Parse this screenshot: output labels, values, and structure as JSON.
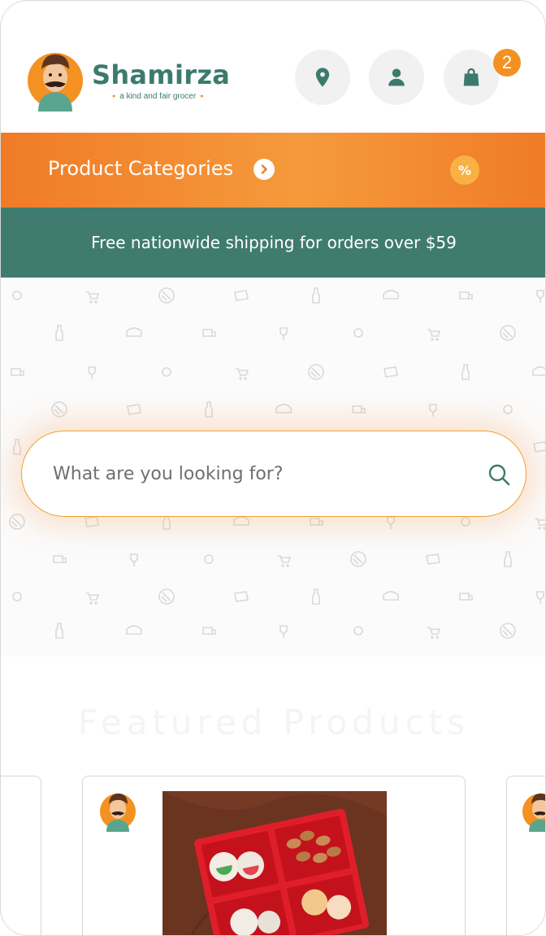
{
  "brand": {
    "name": "Shamirza",
    "tagline": "a kind and fair grocer"
  },
  "header": {
    "cart_count": "2"
  },
  "categories_bar": {
    "label": "Product Categories",
    "discount_symbol": "%"
  },
  "shipping_banner": {
    "text": "Free nationwide shipping for orders over $59"
  },
  "search": {
    "placeholder": "What are you looking for?"
  },
  "featured": {
    "title": "Featured Products"
  },
  "colors": {
    "brand_green": "#3f7b6f",
    "brand_orange": "#f07b27",
    "badge_orange": "#f39123"
  },
  "icons": [
    "location-pin-icon",
    "user-icon",
    "shopping-bag-icon",
    "chevron-right-icon",
    "percent-icon",
    "search-icon"
  ]
}
